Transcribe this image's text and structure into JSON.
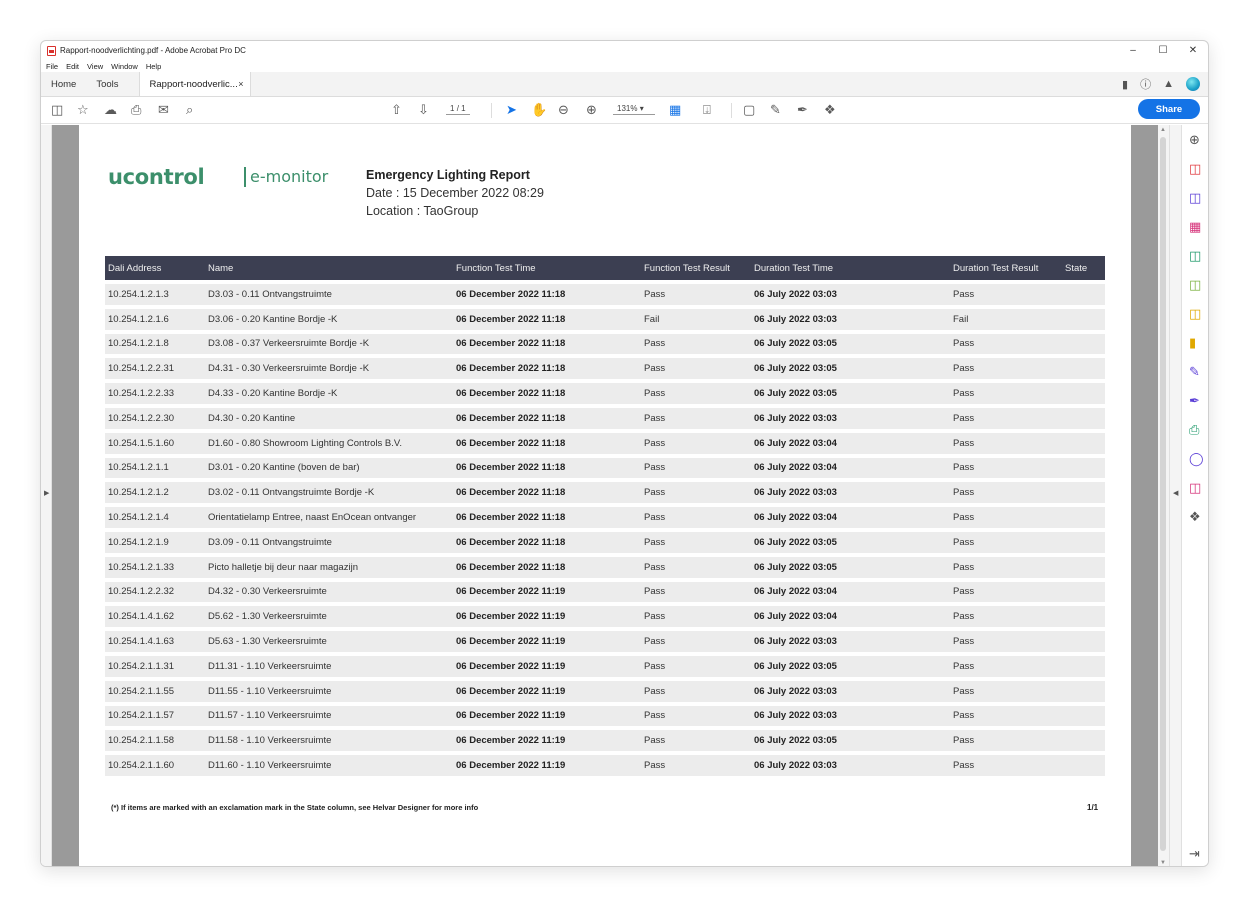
{
  "window": {
    "title": "Rapport-noodverlichting.pdf - Adobe Acrobat Pro DC",
    "controls": {
      "minimize": "–",
      "maximize": "☐",
      "close": "✕"
    }
  },
  "menu": [
    "File",
    "Edit",
    "View",
    "Window",
    "Help"
  ],
  "tabs": {
    "home": "Home",
    "tools": "Tools",
    "document": "Rapport-noodverlic...",
    "close": "×"
  },
  "toolbar": {
    "page_current": "1",
    "page_total": "/ 1",
    "zoom": "131%",
    "share_label": "Share"
  },
  "report": {
    "logo_main": "ucontrol",
    "logo_sub": "e-monitor",
    "title": "Emergency Lighting Report",
    "date": "Date : 15 December 2022 08:29",
    "location": "Location : TaoGroup",
    "columns": [
      "Dali Address",
      "Name",
      "Function Test Time",
      "Function Test Result",
      "Duration Test Time",
      "Duration Test Result",
      "State"
    ],
    "rows": [
      [
        "10.254.1.2.1.3",
        "D3.03 - 0.11 Ontvangstruimte",
        "06 December 2022 11:18",
        "Pass",
        "06 July 2022 03:03",
        "Pass",
        ""
      ],
      [
        "10.254.1.2.1.6",
        "D3.06 - 0.20 Kantine Bordje -K",
        "06 December 2022 11:18",
        "Fail",
        "06 July 2022 03:03",
        "Fail",
        ""
      ],
      [
        "10.254.1.2.1.8",
        "D3.08 - 0.37 Verkeersruimte Bordje -K",
        "06 December 2022 11:18",
        "Pass",
        "06 July 2022 03:05",
        "Pass",
        ""
      ],
      [
        "10.254.1.2.2.31",
        "D4.31 - 0.30 Verkeersruimte Bordje -K",
        "06 December 2022 11:18",
        "Pass",
        "06 July 2022 03:05",
        "Pass",
        ""
      ],
      [
        "10.254.1.2.2.33",
        "D4.33 - 0.20 Kantine Bordje -K",
        "06 December 2022 11:18",
        "Pass",
        "06 July 2022 03:05",
        "Pass",
        ""
      ],
      [
        "10.254.1.2.2.30",
        "D4.30 - 0.20 Kantine",
        "06 December 2022 11:18",
        "Pass",
        "06 July 2022 03:03",
        "Pass",
        ""
      ],
      [
        "10.254.1.5.1.60",
        "D1.60 - 0.80 Showroom Lighting Controls B.V.",
        "06 December 2022 11:18",
        "Pass",
        "06 July 2022 03:04",
        "Pass",
        ""
      ],
      [
        "10.254.1.2.1.1",
        "D3.01 - 0.20 Kantine (boven de bar)",
        "06 December 2022 11:18",
        "Pass",
        "06 July 2022 03:04",
        "Pass",
        ""
      ],
      [
        "10.254.1.2.1.2",
        "D3.02 - 0.11 Ontvangstruimte Bordje -K",
        "06 December 2022 11:18",
        "Pass",
        "06 July 2022 03:03",
        "Pass",
        ""
      ],
      [
        "10.254.1.2.1.4",
        "Orientatielamp Entree, naast EnOcean ontvanger",
        "06 December 2022 11:18",
        "Pass",
        "06 July 2022 03:04",
        "Pass",
        ""
      ],
      [
        "10.254.1.2.1.9",
        "D3.09 - 0.11 Ontvangstruimte",
        "06 December 2022 11:18",
        "Pass",
        "06 July 2022 03:05",
        "Pass",
        ""
      ],
      [
        "10.254.1.2.1.33",
        "Picto halletje bij deur naar magazijn",
        "06 December 2022 11:18",
        "Pass",
        "06 July 2022 03:05",
        "Pass",
        ""
      ],
      [
        "10.254.1.2.2.32",
        "D4.32 - 0.30 Verkeersruimte",
        "06 December 2022 11:19",
        "Pass",
        "06 July 2022 03:04",
        "Pass",
        ""
      ],
      [
        "10.254.1.4.1.62",
        "D5.62 - 1.30 Verkeersruimte",
        "06 December 2022 11:19",
        "Pass",
        "06 July 2022 03:04",
        "Pass",
        ""
      ],
      [
        "10.254.1.4.1.63",
        "D5.63 - 1.30 Verkeersruimte",
        "06 December 2022 11:19",
        "Pass",
        "06 July 2022 03:03",
        "Pass",
        ""
      ],
      [
        "10.254.2.1.1.31",
        "D11.31 - 1.10 Verkeersruimte",
        "06 December 2022 11:19",
        "Pass",
        "06 July 2022 03:05",
        "Pass",
        ""
      ],
      [
        "10.254.2.1.1.55",
        "D11.55 - 1.10 Verkeersruimte",
        "06 December 2022 11:19",
        "Pass",
        "06 July 2022 03:03",
        "Pass",
        ""
      ],
      [
        "10.254.2.1.1.57",
        "D11.57 - 1.10 Verkeersruimte",
        "06 December 2022 11:19",
        "Pass",
        "06 July 2022 03:03",
        "Pass",
        ""
      ],
      [
        "10.254.2.1.1.58",
        "D11.58 - 1.10 Verkeersruimte",
        "06 December 2022 11:19",
        "Pass",
        "06 July 2022 03:05",
        "Pass",
        ""
      ],
      [
        "10.254.2.1.1.60",
        "D11.60 - 1.10 Verkeersruimte",
        "06 December 2022 11:19",
        "Pass",
        "06 July 2022 03:03",
        "Pass",
        ""
      ]
    ],
    "footnote": "(*) If items are marked with an exclamation mark in the State column, see Helvar Designer for more info",
    "page_number": "1/1"
  },
  "colors": {
    "brand_green": "#3c8f6b",
    "header_dark": "#3c3f52",
    "pass": "#3cc07a",
    "fail": "#d0202a",
    "share_blue": "#1473e6"
  }
}
